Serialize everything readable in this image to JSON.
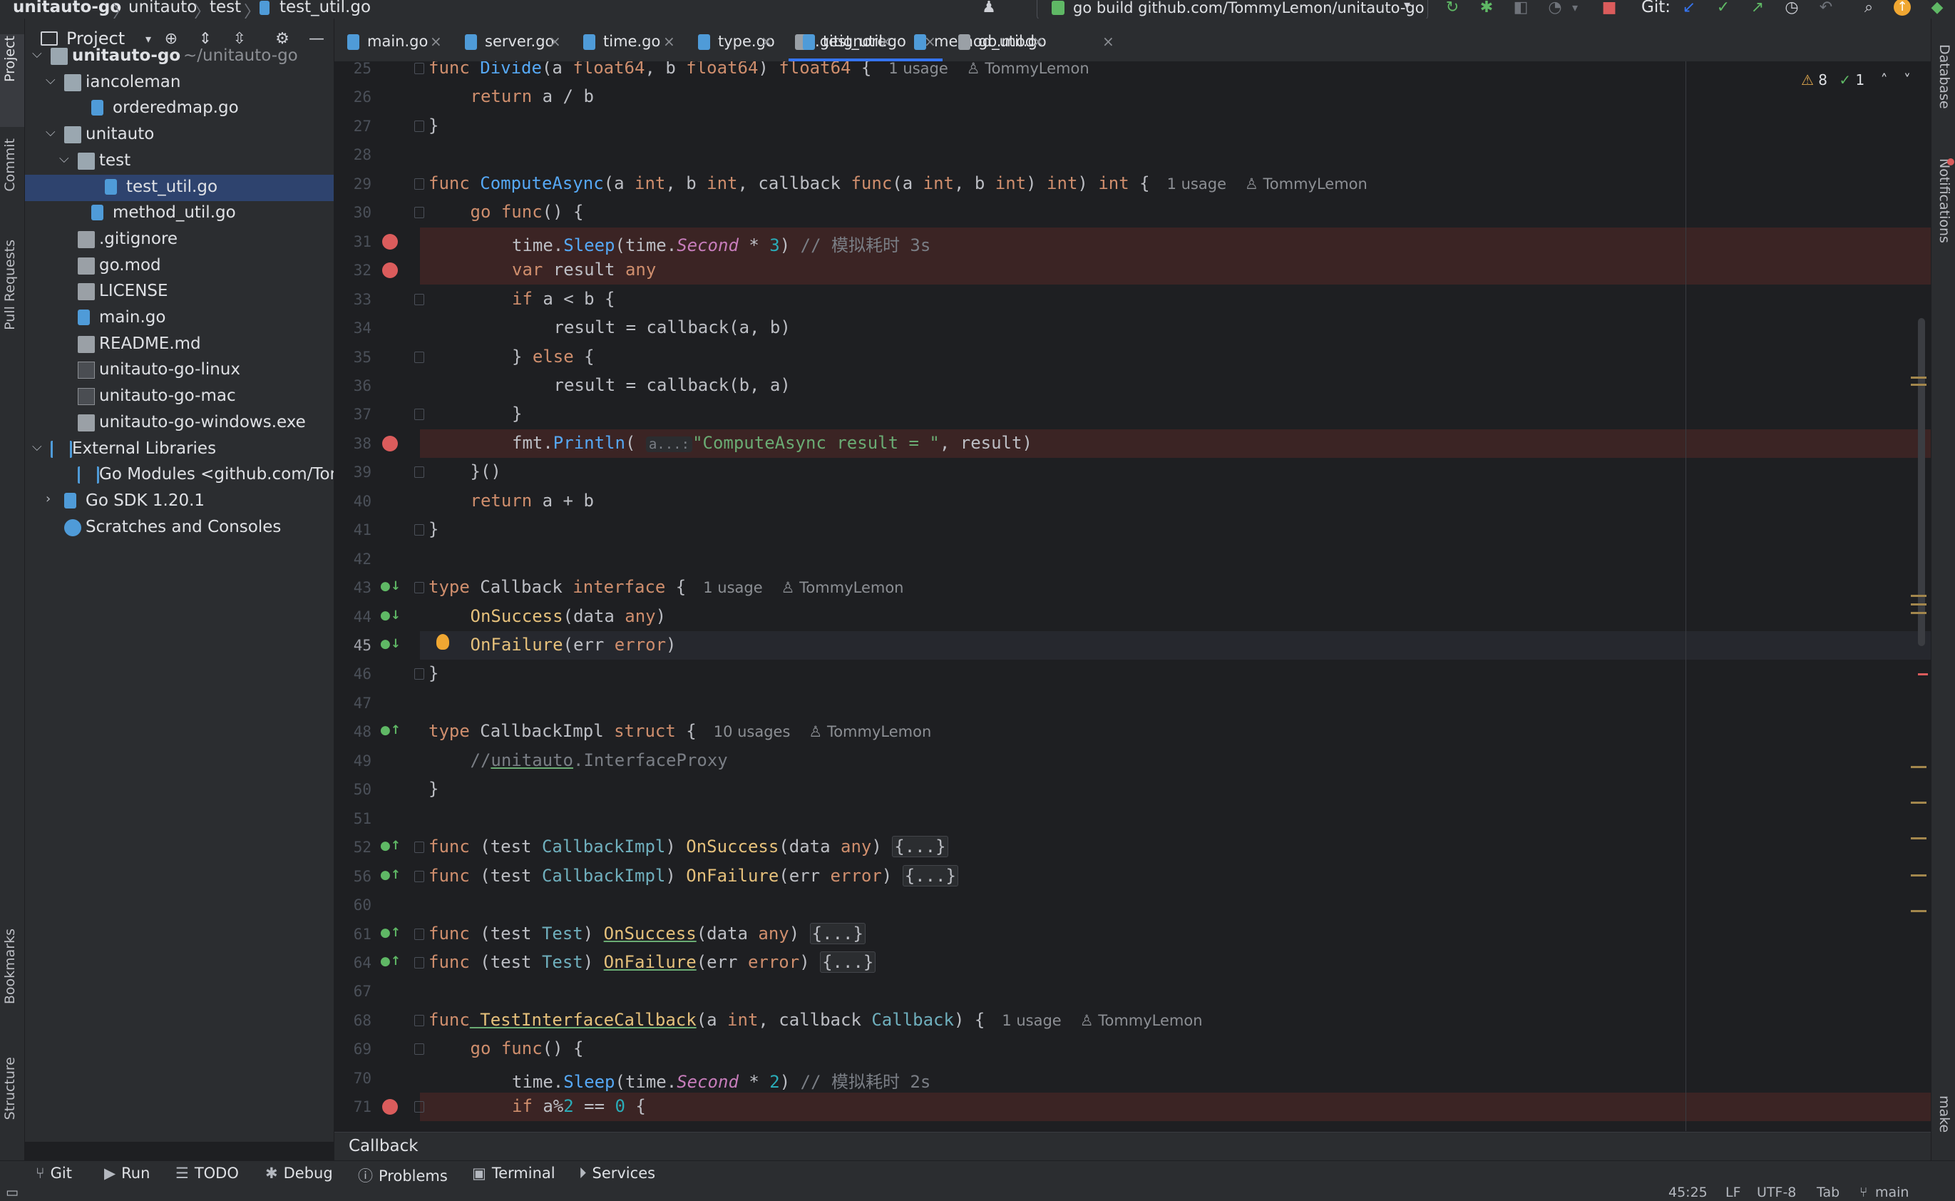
{
  "nav": {
    "crumbs": [
      "unitauto-go",
      "unitauto",
      "test",
      "test_util.go"
    ],
    "run_config": "go build github.com/TommyLemon/unitauto-go",
    "git_label": "Git:"
  },
  "left_stripe": {
    "items": [
      "Project",
      "Commit",
      "Pull Requests",
      "Bookmarks",
      "Structure"
    ]
  },
  "right_stripe": {
    "items": [
      "Database",
      "Notifications",
      "make"
    ]
  },
  "project": {
    "title": "Project",
    "tree": [
      {
        "label": "unitauto-go",
        "dim": "~/unitauto-go",
        "depth": 0,
        "kind": "folder",
        "expanded": true,
        "bold": true
      },
      {
        "label": "iancoleman",
        "depth": 1,
        "kind": "folder",
        "expanded": true
      },
      {
        "label": "orderedmap.go",
        "depth": 3,
        "kind": "go"
      },
      {
        "label": "unitauto",
        "depth": 1,
        "kind": "folder",
        "expanded": true
      },
      {
        "label": "test",
        "depth": 2,
        "kind": "folder",
        "expanded": true
      },
      {
        "label": "test_util.go",
        "depth": 4,
        "kind": "go",
        "selected": true
      },
      {
        "label": "method_util.go",
        "depth": 3,
        "kind": "go"
      },
      {
        "label": ".gitignore",
        "depth": 2,
        "kind": "text"
      },
      {
        "label": "go.mod",
        "depth": 2,
        "kind": "text"
      },
      {
        "label": "LICENSE",
        "depth": 2,
        "kind": "text"
      },
      {
        "label": "main.go",
        "depth": 2,
        "kind": "go"
      },
      {
        "label": "README.md",
        "depth": 2,
        "kind": "text"
      },
      {
        "label": "unitauto-go-linux",
        "depth": 2,
        "kind": "bin"
      },
      {
        "label": "unitauto-go-mac",
        "depth": 2,
        "kind": "bin"
      },
      {
        "label": "unitauto-go-windows.exe",
        "depth": 2,
        "kind": "text"
      },
      {
        "label": "External Libraries",
        "depth": 0,
        "kind": "lib",
        "expanded": true
      },
      {
        "label": "Go Modules <github.com/Tom",
        "depth": 2,
        "kind": "lib"
      },
      {
        "label": "Go SDK 1.20.1",
        "depth": 1,
        "kind": "go",
        "collapsed": true
      },
      {
        "label": "Scratches and Consoles",
        "depth": 1,
        "kind": "scratch"
      }
    ]
  },
  "tabs": [
    {
      "label": "main.go"
    },
    {
      "label": "server.go"
    },
    {
      "label": "time.go"
    },
    {
      "label": "type.go"
    },
    {
      "label": ".gitignore"
    },
    {
      "label": "method_util.go"
    },
    {
      "label": "test_util.go",
      "active": true
    },
    {
      "label": "go.mod"
    }
  ],
  "inspections": {
    "warnings": "8",
    "ok": "1"
  },
  "editor": {
    "current_line": "45",
    "lines": [
      {
        "n": "25",
        "html_key": "l25"
      },
      {
        "n": "26"
      },
      {
        "n": "27"
      },
      {
        "n": "28"
      },
      {
        "n": "29"
      },
      {
        "n": "30"
      },
      {
        "n": "31",
        "bp": true
      },
      {
        "n": "32",
        "bp": true
      },
      {
        "n": "33"
      },
      {
        "n": "34"
      },
      {
        "n": "35"
      },
      {
        "n": "36"
      },
      {
        "n": "37"
      },
      {
        "n": "38",
        "bp": true
      },
      {
        "n": "39"
      },
      {
        "n": "40"
      },
      {
        "n": "41"
      },
      {
        "n": "42"
      },
      {
        "n": "43"
      },
      {
        "n": "44"
      },
      {
        "n": "45"
      },
      {
        "n": "46"
      },
      {
        "n": "47"
      },
      {
        "n": "48"
      },
      {
        "n": "49"
      },
      {
        "n": "50"
      },
      {
        "n": "51"
      },
      {
        "n": "52"
      },
      {
        "n": "56"
      },
      {
        "n": "60"
      },
      {
        "n": "61"
      },
      {
        "n": "64"
      },
      {
        "n": "67"
      },
      {
        "n": "68"
      },
      {
        "n": "69"
      },
      {
        "n": "70"
      },
      {
        "n": "71",
        "bp": true
      }
    ],
    "code": {
      "l25_a": "func ",
      "l25_fn": "Divide",
      "l25_b": "(a ",
      "l25_t1": "float64",
      "l25_c": ", b ",
      "l25_t2": "float64",
      "l25_d": ") ",
      "l25_t3": "float64",
      "l25_e": " {",
      "l25_u": "1 usage",
      "l25_au": "TommyLemon",
      "l26_kw": "return",
      "l26_r": " a / b",
      "l27": "}",
      "l29_a": "func ",
      "l29_fn": "ComputeAsync",
      "l29_b": "(a ",
      "l29_t1": "int",
      "l29_c": ", b ",
      "l29_t2": "int",
      "l29_d": ", callback ",
      "l29_kw": "func",
      "l29_e": "(a ",
      "l29_t3": "int",
      "l29_f": ", b ",
      "l29_t4": "int",
      "l29_g": ") ",
      "l29_t5": "int",
      "l29_h": ") ",
      "l29_t6": "int",
      "l29_i": " {",
      "l29_u": "1 usage",
      "l29_au": "TommyLemon",
      "l30_kw": "go ",
      "l30_kw2": "func",
      "l30_r": "() {",
      "l31_a": "time.",
      "l31_fn": "Sleep",
      "l31_b": "(time.",
      "l31_f": "Second",
      "l31_c": " * ",
      "l31_n": "3",
      "l31_d": ") ",
      "l31_cm": "// 模拟耗时 3s",
      "l32_kw": "var",
      "l32_a": " result ",
      "l32_t": "any",
      "l33_kw": "if",
      "l33_r": " a < b {",
      "l34": "result = callback(a, b)",
      "l35_a": "} ",
      "l35_kw": "else",
      "l35_b": " {",
      "l36": "result = callback(b, a)",
      "l37": "}",
      "l38_a": "fmt.",
      "l38_fn": "Println",
      "l38_b": "( ",
      "l38_h": "a...:",
      "l38_s": "\"ComputeAsync result = \"",
      "l38_c": ", result)",
      "l39": "}()",
      "l40_kw": "return",
      "l40_r": " a + b",
      "l41": "}",
      "l43_kw": "type",
      "l43_a": " Callback ",
      "l43_kw2": "interface",
      "l43_b": " {",
      "l43_u": "1 usage",
      "l43_au": "TommyLemon",
      "l44_fn": "OnSuccess",
      "l44_a": "(data ",
      "l44_t": "any",
      "l44_b": ")",
      "l45_fn": "OnFailure",
      "l45_a": "(err ",
      "l45_t": "error",
      "l45_b": ")",
      "l46": "}",
      "l48_kw": "type",
      "l48_a": " CallbackImpl ",
      "l48_kw2": "struct",
      "l48_b": " {",
      "l48_u": "10 usages",
      "l48_au": "TommyLemon",
      "l49_a": "//",
      "l49_b": "unitauto",
      "l49_c": ".InterfaceProxy",
      "l50": "}",
      "l52_kw": "func",
      "l52_a": " (test ",
      "l52_t": "CallbackImpl",
      "l52_b": ") ",
      "l52_fn": "OnSuccess",
      "l52_c": "(data ",
      "l52_t2": "any",
      "l52_d": ") ",
      "l52_f": "{...}",
      "l56_kw": "func",
      "l56_a": " (test ",
      "l56_t": "CallbackImpl",
      "l56_b": ") ",
      "l56_fn": "OnFailure",
      "l56_c": "(err ",
      "l56_t2": "error",
      "l56_d": ") ",
      "l56_f": "{...}",
      "l61_kw": "func",
      "l61_a": " (test ",
      "l61_t": "Test",
      "l61_b": ") ",
      "l61_fn": "OnSuccess",
      "l61_c": "(data ",
      "l61_t2": "any",
      "l61_d": ") ",
      "l61_f": "{...}",
      "l64_kw": "func",
      "l64_a": " (test ",
      "l64_t": "Test",
      "l64_b": ") ",
      "l64_fn": "OnFailure",
      "l64_c": "(err ",
      "l64_t2": "error",
      "l64_d": ") ",
      "l64_f": "{...}",
      "l68_kw": "func",
      "l68_fn": " TestInterfaceCallback",
      "l68_a": "(a ",
      "l68_t": "int",
      "l68_b": ", callback ",
      "l68_t2": "Callback",
      "l68_c": ") {",
      "l68_u": "1 usage",
      "l68_au": "TommyLemon",
      "l69_kw": "go ",
      "l69_kw2": "func",
      "l69_r": "() {",
      "l70_a": "time.",
      "l70_fn": "Sleep",
      "l70_b": "(time.",
      "l70_f": "Second",
      "l70_c": " * ",
      "l70_n": "2",
      "l70_d": ") ",
      "l70_cm": "// 模拟耗时 2s",
      "l71_kw": "if",
      "l71_a": " a%",
      "l71_n": "2",
      "l71_b": " == ",
      "l71_n2": "0",
      "l71_c": " {"
    }
  },
  "breadcrumb_bar": {
    "text": "Callback"
  },
  "bottom_tools": [
    "Git",
    "Run",
    "TODO",
    "Debug",
    "Problems",
    "Terminal",
    "Services"
  ],
  "status": {
    "position": "45:25",
    "line_sep": "LF",
    "encoding": "UTF-8",
    "indent": "Tab",
    "branch": "main"
  },
  "colors": {
    "accent": "#3574f0",
    "breakpoint": "#db5c5c",
    "selection": "#2e436e"
  }
}
